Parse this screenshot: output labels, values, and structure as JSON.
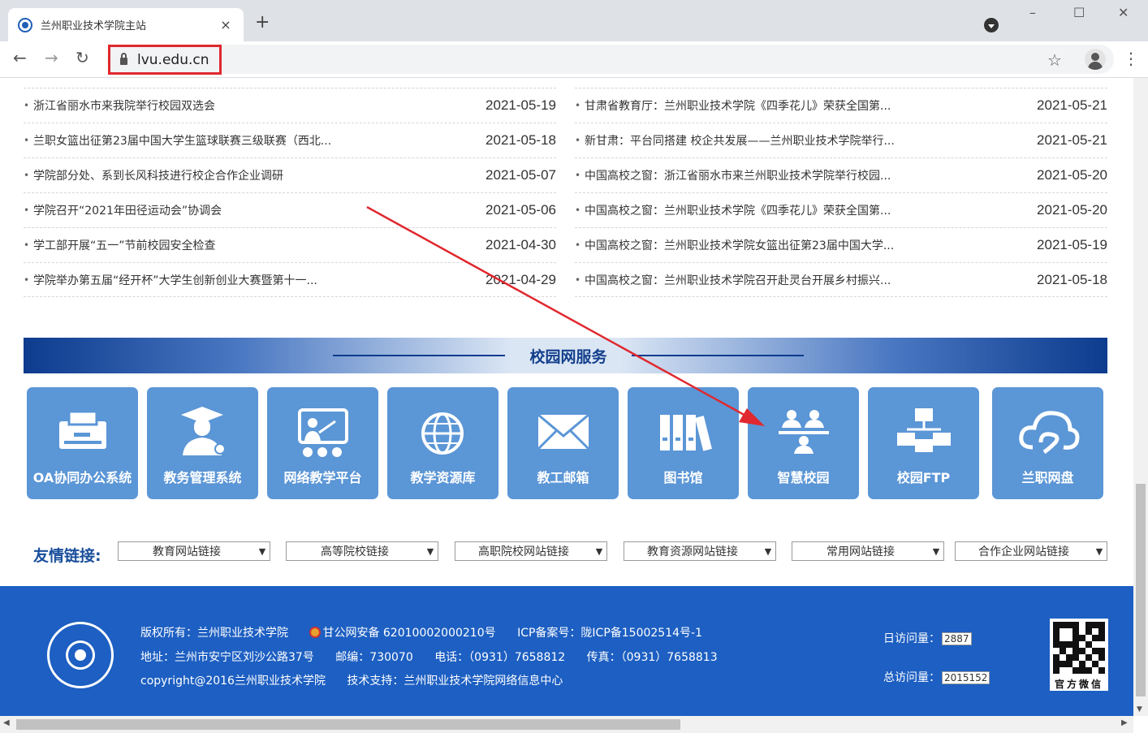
{
  "browser": {
    "tab_title": "兰州职业技术学院主站",
    "tab_close": "×",
    "new_tab": "+",
    "minimize": "–",
    "maximize": "☐",
    "close": "✕",
    "back": "←",
    "forward": "→",
    "reload": "↻",
    "url": "lvu.edu.cn",
    "star": "☆",
    "menu": "⋮"
  },
  "news": {
    "left": [
      {
        "title": "浙江省丽水市来我院举行校园双选会",
        "date": "2021-05-19"
      },
      {
        "title": "兰职女篮出征第23届中国大学生篮球联赛三级联赛（西北...",
        "date": "2021-05-18"
      },
      {
        "title": "学院部分处、系到长风科技进行校企合作企业调研",
        "date": "2021-05-07"
      },
      {
        "title": "学院召开“2021年田径运动会”协调会",
        "date": "2021-05-06"
      },
      {
        "title": "学工部开展“五一”节前校园安全检查",
        "date": "2021-04-30"
      },
      {
        "title": "学院举办第五届“经开杯”大学生创新创业大赛暨第十一...",
        "date": "2021-04-29"
      }
    ],
    "right": [
      {
        "title": "甘肃省教育厅：兰州职业技术学院《四季花儿》荣获全国第...",
        "date": "2021-05-21"
      },
      {
        "title": "新甘肃：平台同搭建 校企共发展——兰州职业技术学院举行...",
        "date": "2021-05-21"
      },
      {
        "title": "中国高校之窗：浙江省丽水市来兰州职业技术学院举行校园...",
        "date": "2021-05-20"
      },
      {
        "title": "中国高校之窗：兰州职业技术学院《四季花儿》荣获全国第...",
        "date": "2021-05-20"
      },
      {
        "title": "中国高校之窗：兰州职业技术学院女篮出征第23届中国大学...",
        "date": "2021-05-19"
      },
      {
        "title": "中国高校之窗：兰州职业技术学院召开赴灵台开展乡村振兴...",
        "date": "2021-05-18"
      }
    ]
  },
  "services": {
    "title": "校园网服务",
    "tiles": [
      {
        "label": "OA协同办公系统",
        "icon": "printer-icon"
      },
      {
        "label": "教务管理系统",
        "icon": "graduate-icon"
      },
      {
        "label": "网络教学平台",
        "icon": "teacher-board-icon"
      },
      {
        "label": "教学资源库",
        "icon": "globe-icon"
      },
      {
        "label": "教工邮箱",
        "icon": "mail-icon"
      },
      {
        "label": "图书馆",
        "icon": "books-icon"
      },
      {
        "label": "智慧校园",
        "icon": "people-network-icon"
      },
      {
        "label": "校园FTP",
        "icon": "network-icon"
      },
      {
        "label": "兰职网盘",
        "icon": "cloud-icon"
      }
    ]
  },
  "links": {
    "label": "友情链接:",
    "selects": [
      "教育网站链接",
      "高等院校链接",
      "高职院校网站链接",
      "教育资源网站链接",
      "常用网站链接",
      "合作企业网站链接"
    ]
  },
  "footer": {
    "copyright_owner": "版权所有：兰州职业技术学院",
    "police_record": "甘公网安备 62010002000210号",
    "icp": "ICP备案号：陇ICP备15002514号-1",
    "address": "地址：兰州市安宁区刘沙公路37号",
    "postcode": "邮编：730070",
    "phone": "电话：（0931）7658812",
    "fax": "传真：（0931）7658813",
    "copyright": "copyright@2016兰州职业技术学院",
    "support": "技术支持：兰州职业技术学院网络信息中心",
    "daily_label": "日访问量：",
    "daily_value": "2887",
    "total_label": "总访问量：",
    "total_value": "2015152",
    "qr_caption": "官方微信"
  },
  "colors": {
    "tile": "#5b96d6",
    "footer": "#1d5fc2",
    "url_highlight": "#e0282e",
    "arrow": "#e0282e"
  }
}
